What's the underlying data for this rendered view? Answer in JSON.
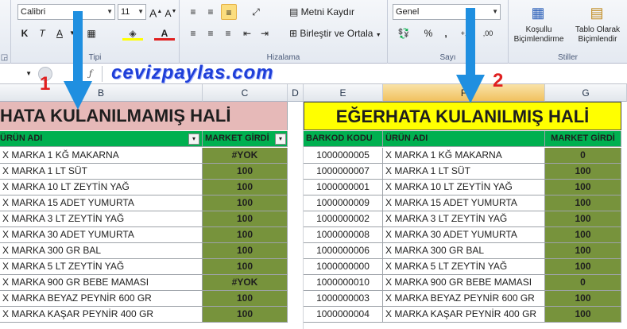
{
  "ribbon": {
    "font": {
      "name": "Calibri",
      "size": "11",
      "group_label": "Tipi"
    },
    "alignment": {
      "wrap_text": "Metni Kaydır",
      "merge_center": "Birleştir ve Ortala",
      "group_label": "Hizalama"
    },
    "number": {
      "format": "Genel",
      "group_label": "Sayı"
    },
    "styles": {
      "conditional": "Koşullu Biçimlendirme",
      "table": "Tablo Olarak Biçimlendir",
      "group_label": "Stiller"
    }
  },
  "watermark": "cevizpaylas.com",
  "columns": [
    "B",
    "C",
    "D",
    "E",
    "F",
    "G"
  ],
  "labels": {
    "left_number": "1",
    "right_number": "2"
  },
  "left_table": {
    "title": "HATA KULANILMAMIŞ HALİ",
    "headers": [
      "ÜRÜN ADI",
      "MARKET GİRDİ"
    ],
    "rows": [
      [
        "X MARKA 1 KĞ MAKARNA",
        "#YOK"
      ],
      [
        "X MARKA 1 LT SÜT",
        "100"
      ],
      [
        "X MARKA 10 LT ZEYTİN YAĞ",
        "100"
      ],
      [
        "X MARKA 15 ADET YUMURTA",
        "100"
      ],
      [
        "X MARKA 3 LT ZEYTİN YAĞ",
        "100"
      ],
      [
        "X MARKA 30 ADET YUMURTA",
        "100"
      ],
      [
        "X MARKA 300 GR BAL",
        "100"
      ],
      [
        "X MARKA 5 LT ZEYTİN YAĞ",
        "100"
      ],
      [
        "X MARKA 900 GR BEBE MAMASI",
        "#YOK"
      ],
      [
        "X MARKA BEYAZ PEYNİR 600 GR",
        "100"
      ],
      [
        "X MARKA KAŞAR PEYNİR 400 GR",
        "100"
      ]
    ]
  },
  "right_table": {
    "title": "EĞERHATA KULANILMIŞ HALİ",
    "headers": [
      "BARKOD KODU",
      "ÜRÜN ADI",
      "MARKET GİRDİ"
    ],
    "rows": [
      [
        "1000000005",
        "X MARKA 1 KĞ MAKARNA",
        "0"
      ],
      [
        "1000000007",
        "X MARKA 1 LT SÜT",
        "100"
      ],
      [
        "1000000001",
        "X MARKA 10 LT ZEYTİN YAĞ",
        "100"
      ],
      [
        "1000000009",
        "X MARKA 15 ADET YUMURTA",
        "100"
      ],
      [
        "1000000002",
        "X MARKA 3 LT ZEYTİN YAĞ",
        "100"
      ],
      [
        "1000000008",
        "X MARKA 30 ADET YUMURTA",
        "100"
      ],
      [
        "1000000006",
        "X MARKA 300 GR BAL",
        "100"
      ],
      [
        "1000000000",
        "X MARKA 5 LT ZEYTİN YAĞ",
        "100"
      ],
      [
        "1000000010",
        "X MARKA 900 GR BEBE MAMASI",
        "0"
      ],
      [
        "1000000003",
        "X MARKA BEYAZ PEYNİR 600 GR",
        "100"
      ],
      [
        "1000000004",
        "X MARKA KAŞAR PEYNİR 400 GR",
        "100"
      ]
    ]
  },
  "colors": {
    "left_title_bg": "#e6b9b8",
    "right_title_bg": "#ffff00",
    "header_green": "#00b050",
    "value_green": "#77933c",
    "arrow_blue": "#1f8fe0",
    "number_red": "#e02020",
    "watermark": "#1f3fd8"
  }
}
